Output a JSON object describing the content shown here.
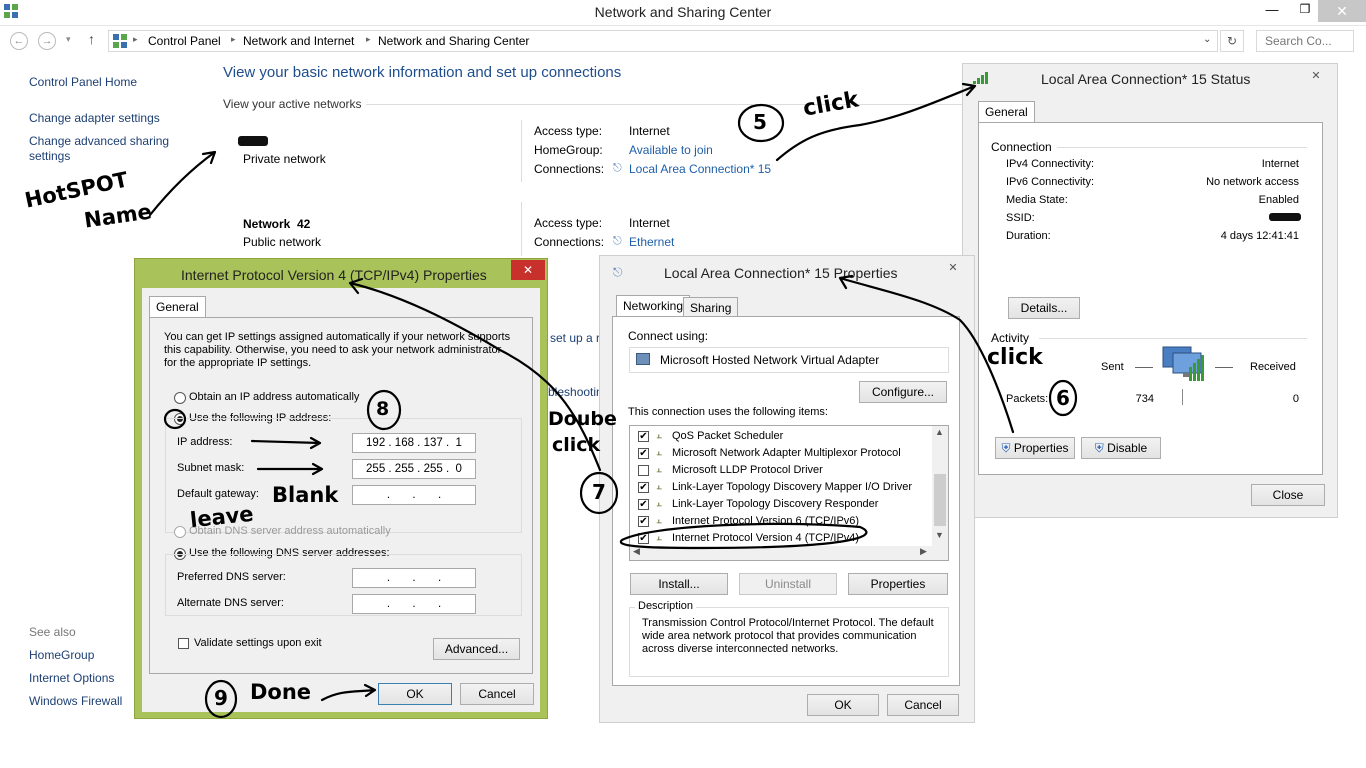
{
  "window": {
    "title": "Network and Sharing Center",
    "min_icon": "minimize-icon",
    "max_icon": "maximize-icon",
    "close_icon": "close-icon"
  },
  "address_bar": {
    "crumbs": [
      "Control Panel",
      "Network and Internet",
      "Network and Sharing Center"
    ],
    "search_placeholder": "Search Co..."
  },
  "sidebar": {
    "home": "Control Panel Home",
    "items": [
      "Change adapter settings",
      "Change advanced sharing settings"
    ],
    "see_also_label": "See also",
    "see_also": [
      "HomeGroup",
      "Internet Options",
      "Windows Firewall"
    ]
  },
  "main": {
    "heading": "View your basic network information and set up connections",
    "active_networks_label": "View your active networks",
    "networks": [
      {
        "name": "",
        "type": "Private network",
        "access_label": "Access type:",
        "access": "Internet",
        "homegroup_label": "HomeGroup:",
        "homegroup": "Available to join",
        "connections_label": "Connections:",
        "connection": "Local Area Connection* 15"
      },
      {
        "name": "Network  42",
        "type": "Public network",
        "access_label": "Access type:",
        "access": "Internet",
        "connections_label": "Connections:",
        "connection": "Ethernet"
      }
    ],
    "partial_set_up": "set up a r",
    "partial_trouble": "bleshootin"
  },
  "ipv4_dialog": {
    "title": "Internet Protocol Version 4 (TCP/IPv4) Properties",
    "tab": "General",
    "intro": [
      "You can get IP settings assigned automatically if your network supports",
      "this capability. Otherwise, you need to ask your network administrator",
      "for the appropriate IP settings."
    ],
    "obtain_ip_auto": "Obtain an IP address automatically",
    "use_ip": "Use the following IP address:",
    "ip_label": "IP address:",
    "ip_value": "192 . 168 . 137 .  1",
    "mask_label": "Subnet mask:",
    "mask_value": "255 . 255 . 255 .  0",
    "gateway_label": "Default gateway:",
    "gateway_value": ".       .       .",
    "obtain_dns_auto": "Obtain DNS server address automatically",
    "use_dns": "Use the following DNS server addresses:",
    "pref_dns_label": "Preferred DNS server:",
    "pref_dns_value": ".       .       .",
    "alt_dns_label": "Alternate DNS server:",
    "alt_dns_value": ".       .       .",
    "validate": "Validate settings upon exit",
    "advanced": "Advanced...",
    "ok": "OK",
    "cancel": "Cancel"
  },
  "props_dialog": {
    "title": "Local Area Connection* 15 Properties",
    "tabs": [
      "Networking",
      "Sharing"
    ],
    "connect_using": "Connect using:",
    "adapter": "Microsoft Hosted Network Virtual Adapter",
    "configure": "Configure...",
    "items_label": "This connection uses the following items:",
    "items": [
      {
        "label": "QoS Packet Scheduler",
        "checked": "true"
      },
      {
        "label": "Microsoft Network Adapter Multiplexor Protocol",
        "checked": "true"
      },
      {
        "label": "Microsoft LLDP Protocol Driver",
        "checked": "false"
      },
      {
        "label": "Link-Layer Topology Discovery Mapper I/O Driver",
        "checked": "true"
      },
      {
        "label": "Link-Layer Topology Discovery Responder",
        "checked": "true"
      },
      {
        "label": "Internet Protocol Version 6 (TCP/IPv6)",
        "checked": "true"
      },
      {
        "label": "Internet Protocol Version 4 (TCP/IPv4)",
        "checked": "true"
      }
    ],
    "install": "Install...",
    "uninstall": "Uninstall",
    "properties": "Properties",
    "description_label": "Description",
    "description": [
      "Transmission Control Protocol/Internet Protocol. The default",
      "wide area network protocol that provides communication",
      "across diverse interconnected networks."
    ],
    "ok": "OK",
    "cancel": "Cancel"
  },
  "status_dialog": {
    "title": "Local Area Connection* 15 Status",
    "tab": "General",
    "connection_label": "Connection",
    "rows": [
      {
        "label": "IPv4 Connectivity:",
        "value": "Internet"
      },
      {
        "label": "IPv6 Connectivity:",
        "value": "No network access"
      },
      {
        "label": "Media State:",
        "value": "Enabled"
      },
      {
        "label": "SSID:",
        "value": ""
      },
      {
        "label": "Duration:",
        "value": "4 days 12:41:41"
      }
    ],
    "details": "Details...",
    "activity_label": "Activity",
    "sent": "Sent",
    "received": "Received",
    "packets_label": "Packets:",
    "packets_sent": "734",
    "packets_received": "0",
    "properties": "Properties",
    "disable": "Disable",
    "close": "Close"
  },
  "annotations": {
    "hotspot": "HotSPOT",
    "name": "Name",
    "step5": "5",
    "click5": "click",
    "step6": "6",
    "click6": "click",
    "step7": "7",
    "double": "Doube",
    "click7": "click",
    "step8": "8",
    "leave": "leave",
    "blank": "Blank",
    "step9": "9",
    "done": "Done"
  }
}
